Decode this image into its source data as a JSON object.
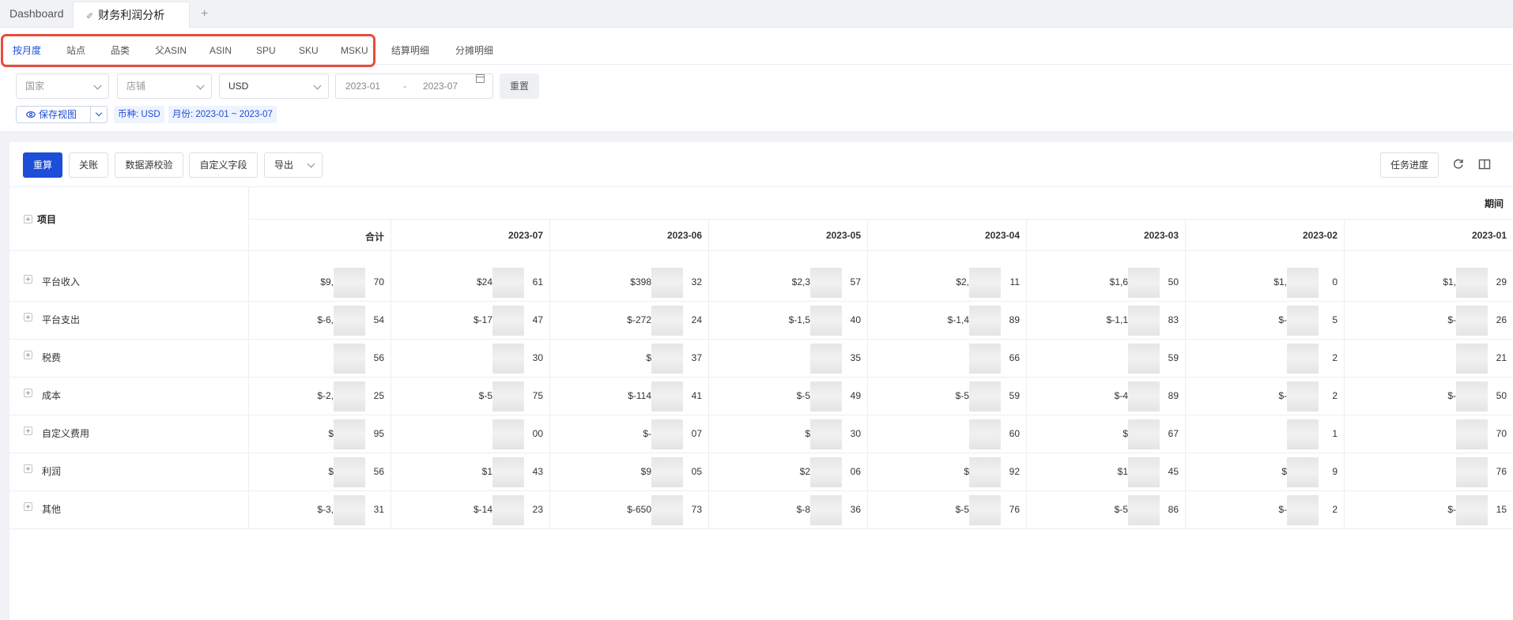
{
  "tabs": {
    "dashboard": "Dashboard",
    "active": "财务利润分析",
    "add": "+"
  },
  "subnav": [
    "按月度",
    "站点",
    "品类",
    "父ASIN",
    "ASIN",
    "SPU",
    "SKU",
    "MSKU",
    "结算明细",
    "分摊明细"
  ],
  "filters": {
    "country_placeholder": "国家",
    "shop_placeholder": "店铺",
    "currency_value": "USD",
    "date_start": "2023-01",
    "date_sep": "-",
    "date_end": "2023-07",
    "reset": "重置"
  },
  "view": {
    "save_view": "保存视图",
    "tag_currency": "币种: USD",
    "tag_month": "月份: 2023-01 ~ 2023-07"
  },
  "toolbar": {
    "recalc": "重算",
    "close_account": "关账",
    "data_check": "数据源校验",
    "custom_field": "自定义字段",
    "export": "导出",
    "task_progress": "任务进度"
  },
  "table": {
    "item_header": "项目",
    "period_header": "期间",
    "columns": [
      "合计",
      "2023-07",
      "2023-06",
      "2023-05",
      "2023-04",
      "2023-03",
      "2023-02",
      "2023-01"
    ],
    "rows": [
      {
        "label": "平台收入",
        "cells": [
          "$9,",
          "$24",
          "$398",
          "$2,3",
          "$2,",
          "$1,6",
          "$1,",
          "$1,"
        ],
        "ends": [
          "70",
          "61",
          "32",
          "57",
          "11",
          "50",
          "0",
          "29"
        ]
      },
      {
        "label": "平台支出",
        "cells": [
          "$-6,",
          "$-17",
          "$-272",
          "$-1,5",
          "$-1,4",
          "$-1,1",
          "$-",
          "$-"
        ],
        "ends": [
          "54",
          "47",
          "24",
          "40",
          "89",
          "83",
          "5",
          "26"
        ]
      },
      {
        "label": "税费",
        "cells": [
          "",
          "",
          "$",
          "",
          "",
          "",
          "",
          ""
        ],
        "ends": [
          "56",
          "30",
          "37",
          "35",
          "66",
          "59",
          "2",
          "21"
        ]
      },
      {
        "label": "成本",
        "cells": [
          "$-2,",
          "$-5",
          "$-114",
          "$-5",
          "$-5",
          "$-4",
          "$-",
          "$-"
        ],
        "ends": [
          "25",
          "75",
          "41",
          "49",
          "59",
          "89",
          "2",
          "50"
        ]
      },
      {
        "label": "自定义费用",
        "cells": [
          "$",
          "",
          "$-",
          "$",
          "",
          "$",
          "",
          ""
        ],
        "ends": [
          "95",
          "00",
          "07",
          "30",
          "60",
          "67",
          "1",
          "70"
        ]
      },
      {
        "label": "利润",
        "cells": [
          "$",
          "$1",
          "$9",
          "$2",
          "$",
          "$1",
          "$",
          ""
        ],
        "ends": [
          "56",
          "43",
          "05",
          "06",
          "92",
          "45",
          "9",
          "76"
        ]
      },
      {
        "label": "其他",
        "cells": [
          "$-3,",
          "$-14",
          "$-650",
          "$-8",
          "$-5",
          "$-5",
          "$-",
          "$-"
        ],
        "ends": [
          "31",
          "23",
          "73",
          "36",
          "76",
          "86",
          "2",
          "15"
        ]
      }
    ]
  }
}
